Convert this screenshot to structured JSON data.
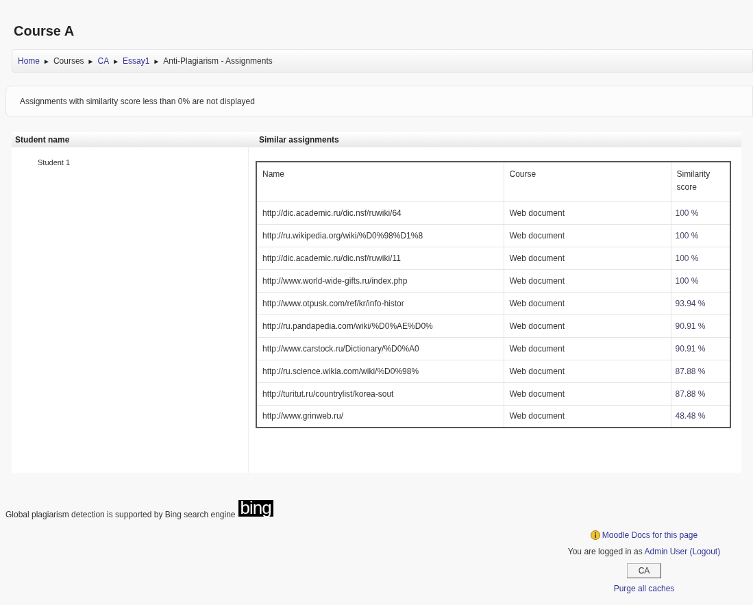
{
  "page_title": "Course A",
  "breadcrumb": {
    "separator": "►",
    "items": [
      {
        "label": "Home",
        "kind": "link"
      },
      {
        "label": "Courses",
        "kind": "text"
      },
      {
        "label": "CA",
        "kind": "link"
      },
      {
        "label": "Essay1",
        "kind": "link"
      },
      {
        "label": "Anti-Plagiarism - Assignments",
        "kind": "text"
      }
    ]
  },
  "notice": "Assignments with similarity score less than 0% are not displayed",
  "report": {
    "columns": [
      "Student name",
      "Similar assignments"
    ],
    "student": "Student 1",
    "assignments": {
      "columns": [
        "Name",
        "Course",
        "Similarity score"
      ],
      "rows": [
        {
          "name": "http://dic.academic.ru/dic.nsf/ruwiki/64",
          "course": "Web document",
          "score": "100 %"
        },
        {
          "name": "http://ru.wikipedia.org/wiki/%D0%98%D1%8",
          "course": "Web document",
          "score": "100 %"
        },
        {
          "name": "http://dic.academic.ru/dic.nsf/ruwiki/11",
          "course": "Web document",
          "score": "100 %"
        },
        {
          "name": "http://www.world-wide-gifts.ru/index.php",
          "course": "Web document",
          "score": "100 %"
        },
        {
          "name": "http://www.otpusk.com/ref/kr/info-histor",
          "course": "Web document",
          "score": "93.94 %"
        },
        {
          "name": "http://ru.pandapedia.com/wiki/%D0%AE%D0%",
          "course": "Web document",
          "score": "90.91 %"
        },
        {
          "name": "http://www.carstock.ru/Dictionary/%D0%A0",
          "course": "Web document",
          "score": "90.91 %"
        },
        {
          "name": "http://ru.science.wikia.com/wiki/%D0%98%",
          "course": "Web document",
          "score": "87.88 %"
        },
        {
          "name": "http://turitut.ru/countrylist/korea-sout",
          "course": "Web document",
          "score": "87.88 %"
        },
        {
          "name": "http://www.grinweb.ru/",
          "course": "Web document",
          "score": "48.48 %"
        }
      ]
    }
  },
  "footer": {
    "support_text": "Global plagiarism detection is supported by Bing search engine",
    "logo": "bing",
    "docs_link": "Moodle Docs for this page",
    "login": {
      "prefix": "You are logged in as",
      "user": "Admin User",
      "logout": "(Logout)"
    },
    "course_button": "CA",
    "purge_link": "Purge all caches"
  }
}
